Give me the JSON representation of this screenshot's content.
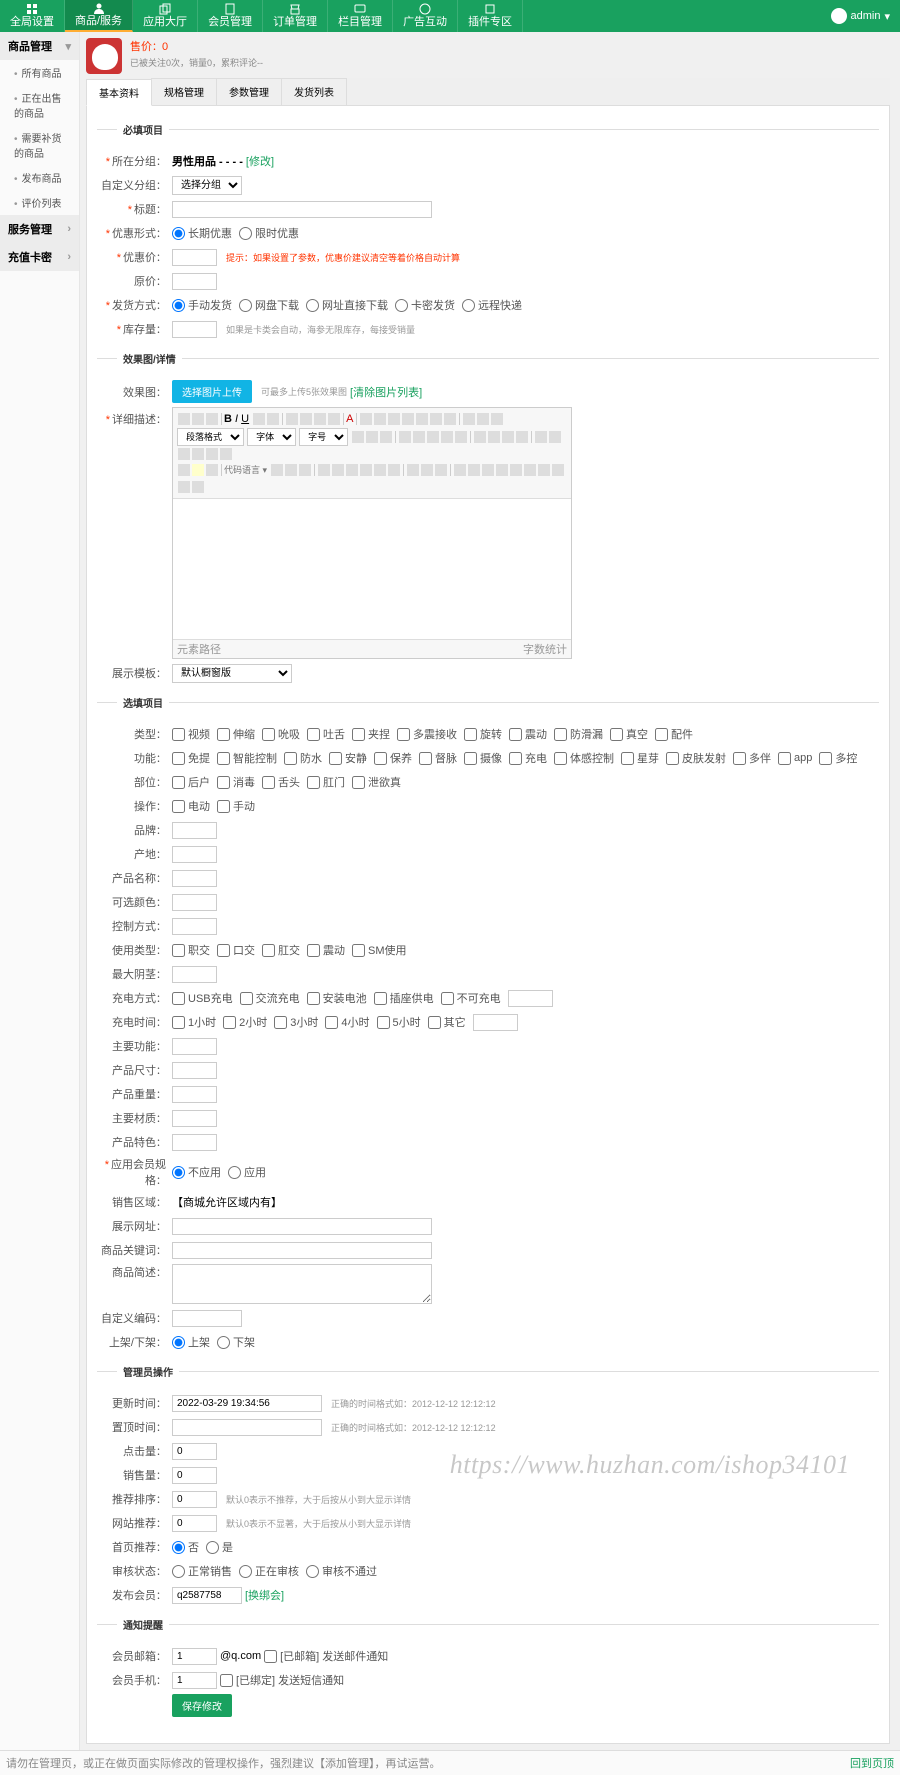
{
  "nav": {
    "items": [
      {
        "label": "全局设置",
        "icon": "grid"
      },
      {
        "label": "商品/服务",
        "icon": "user",
        "active": true
      },
      {
        "label": "应用大厅",
        "icon": "copy"
      },
      {
        "label": "会员管理",
        "icon": "book"
      },
      {
        "label": "订单管理",
        "icon": "market"
      },
      {
        "label": "栏目管理",
        "icon": "msg"
      },
      {
        "label": "广告互动",
        "icon": "ad"
      },
      {
        "label": "插件专区",
        "icon": "plugin"
      }
    ]
  },
  "user": {
    "name": "admin"
  },
  "sidebar": {
    "g1": {
      "title": "商品管理",
      "items": [
        "所有商品",
        "正在出售的商品",
        "需要补货的商品",
        "发布商品",
        "评价列表"
      ]
    },
    "g2": {
      "title": "服务管理"
    },
    "g3": {
      "title": "充值卡密"
    }
  },
  "head": {
    "price_label": "售价",
    "price": "0",
    "meta": "已被关注0次，销量0，累积评论--"
  },
  "tabs": [
    "基本资料",
    "规格管理",
    "参数管理",
    "发货列表"
  ],
  "f1": {
    "legend": "必填项目",
    "cat_lbl": "所在分组",
    "cat_val": "男性用品 - - - -",
    "cat_edit": "[修改]",
    "subcat_lbl": "自定义分组",
    "subcat_sel": "选择分组",
    "title_lbl": "标题",
    "ptype_lbl": "优惠形式",
    "ptype_opts": [
      "长期优惠",
      "限时优惠"
    ],
    "pprice_lbl": "优惠价",
    "pprice_hint": "提示：如果设置了参数，优惠价建议清空等着价格自动计算",
    "oprice_lbl": "原价",
    "ship_lbl": "发货方式",
    "ship_opts": [
      "手动发货",
      "网盘下载",
      "网址直接下载",
      "卡密发货",
      "远程快递"
    ],
    "stock_lbl": "库存量",
    "stock_hint": "如果是卡类会自动，海参无限库存，每接受销量"
  },
  "f2": {
    "legend": "效果图/详情",
    "img_lbl": "效果图",
    "upload": "选择图片上传",
    "img_hint": "可最多上传5张效果图",
    "img_link": "[清除图片列表]",
    "detail_lbl": "详细描述",
    "status_l": "元素路径",
    "status_r": "字数统计",
    "tmpl_lbl": "展示模板",
    "tmpl_sel": "默认橱窗版"
  },
  "f3": {
    "legend": "选填项目",
    "type_lbl": "类型",
    "type_opts": [
      "视频",
      "伸缩",
      "吮吸",
      "吐舌",
      "夹捏",
      "多震接收",
      "旋转",
      "震动",
      "防滑漏",
      "真空",
      "配件"
    ],
    "feat_lbl": "功能",
    "feat_opts": [
      "免提",
      "智能控制",
      "防水",
      "安静",
      "保养",
      "督脉",
      "摄像",
      "充电",
      "体感控制",
      "星芽",
      "皮肤发射",
      "多伴",
      "app",
      "多控"
    ],
    "part_lbl": "部位",
    "part_opts": [
      "后户",
      "消毒",
      "舌头",
      "肛门",
      "泄欲真"
    ],
    "op_lbl": "操作",
    "op_opts": [
      "电动",
      "手动"
    ],
    "brand_lbl": "品牌",
    "origin_lbl": "产地",
    "pname_lbl": "产品名称",
    "color_lbl": "可选颜色",
    "ctrl_lbl": "控制方式",
    "use_lbl": "使用类型",
    "use_opts": [
      "职交",
      "口交",
      "肛交",
      "震动",
      "SM使用"
    ],
    "maxdia_lbl": "最大阴茎",
    "charge_lbl": "充电方式",
    "charge_opts": [
      "USB充电",
      "交流充电",
      "安装电池",
      "插座供电",
      "不可充电"
    ],
    "ctime_lbl": "充电时间",
    "ctime_opts": [
      "1小时",
      "2小时",
      "3小时",
      "4小时",
      "5小时",
      "其它"
    ],
    "mfunc_lbl": "主要功能",
    "psize_lbl": "产品尺寸",
    "pwt_lbl": "产品重量",
    "mmat_lbl": "主要材质",
    "pfeat_lbl": "产品特色",
    "mprice_lbl": "应用会员规格",
    "mprice_opts": [
      "不应用",
      "应用"
    ],
    "region_lbl": "销售区域",
    "region_hint": "【商城允许区域内有】",
    "url_lbl": "展示网址",
    "kw_lbl": "商品关键词",
    "pdesc_lbl": "商品简述",
    "ccode_lbl": "自定义编码",
    "onoff_lbl": "上架/下架",
    "onoff_opts": [
      "上架",
      "下架"
    ]
  },
  "f4": {
    "legend": "管理员操作",
    "utime_lbl": "更新时间",
    "utime_val": "2022-03-29 19:34:56",
    "utime_hint": "正确的时间格式如：2012-12-12 12:12:12",
    "stime_lbl": "置顶时间",
    "stime_hint": "正确的时间格式如：2012-12-12 12:12:12",
    "hits_lbl": "点击量",
    "hits_val": "0",
    "sales_lbl": "销售量",
    "sales_val": "0",
    "rorder_lbl": "推荐排序",
    "rorder_val": "0",
    "rorder_hint": "默认0表示不推荐，大于后按从小到大显示详情",
    "worder_lbl": "网站推荐",
    "worder_val": "0",
    "worder_hint": "默认0表示不显著，大于后按从小到大显示详情",
    "front_lbl": "首页推荐",
    "front_opts": [
      "否",
      "是"
    ],
    "audit_lbl": "审核状态",
    "audit_opts": [
      "正常销售",
      "正在审核",
      "审核不通过"
    ],
    "pub_lbl": "发布会员",
    "pub_val": "q2587758",
    "pub_link": "[换绑会]"
  },
  "f5": {
    "legend": "通知提醒",
    "mail_lbl": "会员邮箱",
    "mail_val": "1",
    "mail_suffix": "@q.com",
    "mail_chk": "[已邮箱] 发送邮件通知",
    "mob_lbl": "会员手机",
    "mob_val": "1",
    "mob_chk": "[已绑定] 发送短信通知",
    "save": "保存修改"
  },
  "footer": {
    "left": "请勿在管理页，或正在做页面实际修改的管理权操作，强烈建议【添加管理】，再试运营。",
    "link": "添加管理",
    "right": "回到页顶"
  },
  "wm": "https://www.huzhan.com/ishop34101"
}
